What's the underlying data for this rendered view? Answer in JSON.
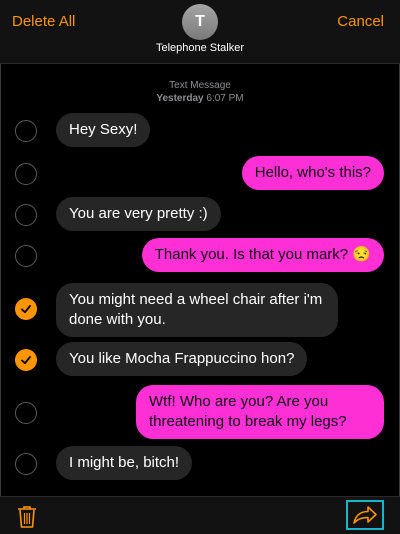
{
  "header": {
    "delete_all_label": "Delete All",
    "cancel_label": "Cancel",
    "avatar_initial": "T",
    "contact_name": "Telephone Stalker"
  },
  "thread": {
    "service_label": "Text Message",
    "day": "Yesterday",
    "time": "6:07 PM"
  },
  "messages": [
    {
      "text": "Hey Sexy!",
      "direction": "incoming",
      "selected": false
    },
    {
      "text": "Hello, who's this?",
      "direction": "outgoing",
      "selected": false
    },
    {
      "text": "You are very pretty :)",
      "direction": "incoming",
      "selected": false
    },
    {
      "text": "Thank you. Is that you mark? 😒",
      "direction": "outgoing",
      "selected": false
    },
    {
      "text": "You might need a wheel chair after i'm done with you.",
      "direction": "incoming",
      "selected": true
    },
    {
      "text": "You like Mocha Frappuccino hon?",
      "direction": "incoming",
      "selected": true
    },
    {
      "text": "Wtf! Who are you? Are you threatening to break my legs?",
      "direction": "outgoing",
      "selected": false
    },
    {
      "text": "I might be, bitch!",
      "direction": "incoming",
      "selected": false
    }
  ],
  "footer": {
    "trash_icon": "trash-icon",
    "share_icon": "forward-share-icon"
  },
  "colors": {
    "accent": "#ff9500",
    "outgoing_bubble": "#ff2fd6",
    "incoming_bubble": "#262626",
    "highlight_border": "#16b8c7"
  }
}
